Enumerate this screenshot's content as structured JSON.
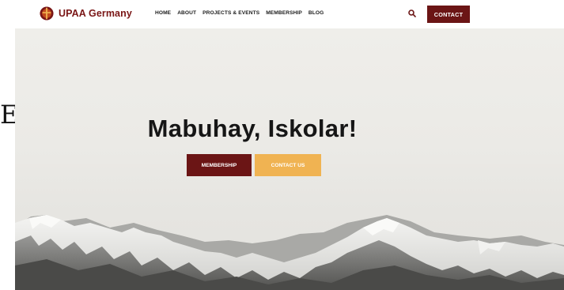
{
  "brand": {
    "name": "UPAA Germany",
    "logo_icon": "upaa-seal-icon",
    "color": "#7a1616"
  },
  "nav": {
    "items": [
      {
        "label": "HOME"
      },
      {
        "label": "ABOUT"
      },
      {
        "label": "PROJECTS & EVENTS"
      },
      {
        "label": "MEMBERSHIP"
      },
      {
        "label": "BLOG"
      }
    ],
    "search_icon": "search-icon",
    "contact_label": "CONTACT"
  },
  "hero": {
    "headline": "Mabuhay, Iskolar!",
    "primary_cta": "MEMBERSHIP",
    "secondary_cta": "CONTACT US"
  },
  "edge_fragment": "E",
  "colors": {
    "maroon": "#6b1515",
    "gold": "#f0b352",
    "text": "#161616"
  }
}
